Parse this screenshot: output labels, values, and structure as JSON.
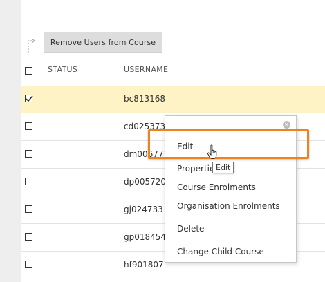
{
  "toolbar": {
    "remove_button_label": "Remove Users from Course"
  },
  "table": {
    "columns": [
      "STATUS",
      "USERNAME"
    ],
    "rows": [
      {
        "username": "bc813168",
        "checked": true
      },
      {
        "username": "cd025373",
        "checked": false
      },
      {
        "username": "dm006771",
        "checked": false
      },
      {
        "username": "dp005720",
        "checked": false
      },
      {
        "username": "gj024733",
        "checked": false
      },
      {
        "username": "gp018454",
        "checked": false
      },
      {
        "username": "hf901807",
        "checked": false
      }
    ]
  },
  "context_menu": {
    "items": [
      "Edit",
      "Properties",
      "Course Enrolments",
      "Organisation Enrolments",
      "Delete",
      "Change Child Course"
    ]
  },
  "tooltip": {
    "text": "Edit"
  },
  "colors": {
    "selected_row": "#fdf3c5",
    "highlight": "#f0821e"
  },
  "icons": {
    "close": "close-icon",
    "cursor": "hand-pointer-icon",
    "bulk_arrow": "bulk-action-arrow-icon",
    "checkbox": "checkbox-icon"
  }
}
